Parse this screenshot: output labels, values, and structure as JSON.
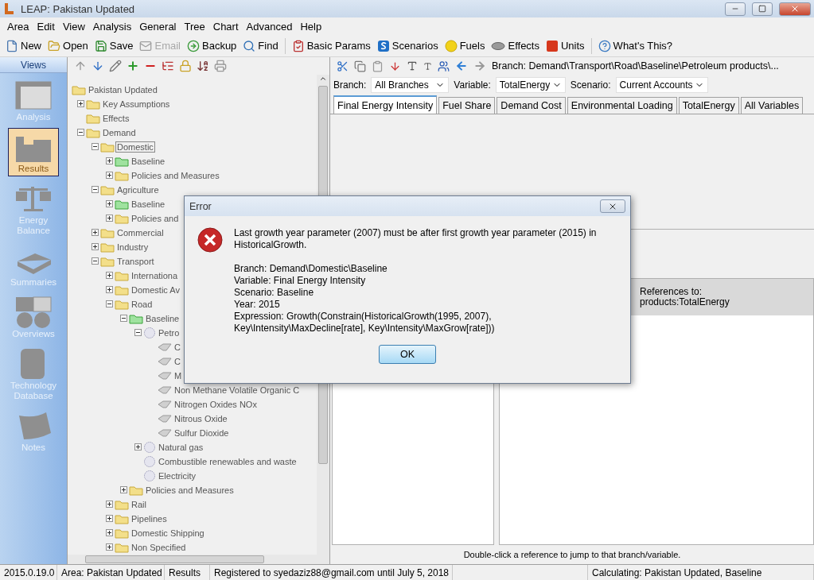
{
  "window": {
    "title": "LEAP: Pakistan Updated"
  },
  "menu": [
    "Area",
    "Edit",
    "View",
    "Analysis",
    "General",
    "Tree",
    "Chart",
    "Advanced",
    "Help"
  ],
  "toolbar": [
    {
      "label": "New",
      "disabled": false
    },
    {
      "label": "Open",
      "disabled": false
    },
    {
      "label": "Save",
      "disabled": false
    },
    {
      "label": "Email",
      "disabled": true
    },
    {
      "label": "Backup",
      "disabled": false
    },
    {
      "label": "Find",
      "disabled": false
    },
    {
      "label": "Basic Params",
      "disabled": false
    },
    {
      "label": "Scenarios",
      "disabled": false
    },
    {
      "label": "Fuels",
      "disabled": false
    },
    {
      "label": "Effects",
      "disabled": false
    },
    {
      "label": "Units",
      "disabled": false
    },
    {
      "label": "What's This?",
      "disabled": false
    }
  ],
  "views": {
    "title": "Views",
    "items": [
      {
        "label": "Analysis",
        "selected": false
      },
      {
        "label": "Results",
        "selected": true
      },
      {
        "label": "Energy Balance",
        "selected": false
      },
      {
        "label": "Summaries",
        "selected": false
      },
      {
        "label": "Overviews",
        "selected": false
      },
      {
        "label": "Technology Database",
        "selected": false
      },
      {
        "label": "Notes",
        "selected": false
      }
    ]
  },
  "tree": [
    {
      "label": "Pakistan Updated",
      "kind": "folder",
      "selected": false,
      "children": [
        {
          "label": "Key Assumptions",
          "kind": "folder",
          "selected": false,
          "expanded": false
        },
        {
          "label": "Effects",
          "kind": "folder",
          "selected": false
        },
        {
          "label": "Demand",
          "kind": "folder",
          "selected": false,
          "expanded": true,
          "children": [
            {
              "label": "Domestic",
              "kind": "folder",
              "selected": true,
              "expanded": true,
              "children": [
                {
                  "label": "Baseline",
                  "kind": "scenario",
                  "selected": false,
                  "expanded": false
                },
                {
                  "label": "Policies and Measures",
                  "kind": "folder",
                  "selected": false,
                  "expanded": false
                }
              ]
            },
            {
              "label": "Agriculture",
              "kind": "folder",
              "selected": false,
              "expanded": true,
              "children": [
                {
                  "label": "Baseline",
                  "kind": "scenario",
                  "selected": false,
                  "expanded": false
                },
                {
                  "label": "Policies and",
                  "kind": "folder",
                  "selected": false,
                  "expanded": false
                }
              ]
            },
            {
              "label": "Commercial",
              "kind": "folder",
              "selected": false,
              "expanded": false
            },
            {
              "label": "Industry",
              "kind": "folder",
              "selected": false,
              "expanded": false
            },
            {
              "label": "Transport",
              "kind": "folder",
              "selected": false,
              "expanded": true,
              "children": [
                {
                  "label": "Internationa",
                  "kind": "folder",
                  "selected": false,
                  "expanded": false
                },
                {
                  "label": "Domestic Av",
                  "kind": "folder",
                  "selected": false,
                  "expanded": false
                },
                {
                  "label": "Road",
                  "kind": "folder",
                  "selected": false,
                  "expanded": true,
                  "children": [
                    {
                      "label": "Baseline",
                      "kind": "scenario",
                      "selected": false,
                      "expanded": true,
                      "children": [
                        {
                          "label": "Petro",
                          "kind": "fuel",
                          "selected": false,
                          "expanded": true,
                          "children": [
                            {
                              "label": "C",
                              "kind": "effect",
                              "selected": false
                            },
                            {
                              "label": "C",
                              "kind": "effect",
                              "selected": false
                            },
                            {
                              "label": "M",
                              "kind": "effect",
                              "selected": false
                            },
                            {
                              "label": "Non Methane Volatile Organic C",
                              "kind": "effect",
                              "selected": false
                            },
                            {
                              "label": "Nitrogen Oxides NOx",
                              "kind": "effect",
                              "selected": false
                            },
                            {
                              "label": "Nitrous Oxide",
                              "kind": "effect",
                              "selected": false
                            },
                            {
                              "label": "Sulfur Dioxide",
                              "kind": "effect",
                              "selected": false
                            }
                          ]
                        },
                        {
                          "label": "Natural gas",
                          "kind": "fuel",
                          "selected": false,
                          "expanded": false
                        },
                        {
                          "label": "Combustible renewables and waste",
                          "kind": "fuel",
                          "selected": false
                        },
                        {
                          "label": "Electricity",
                          "kind": "fuel",
                          "selected": false
                        }
                      ]
                    },
                    {
                      "label": "Policies and Measures",
                      "kind": "folder",
                      "selected": false,
                      "expanded": false
                    }
                  ]
                },
                {
                  "label": "Rail",
                  "kind": "folder",
                  "selected": false,
                  "expanded": false
                },
                {
                  "label": "Pipelines",
                  "kind": "folder",
                  "selected": false,
                  "expanded": false
                },
                {
                  "label": "Domestic Shipping",
                  "kind": "folder",
                  "selected": false,
                  "expanded": false
                },
                {
                  "label": "Non Specified",
                  "kind": "folder",
                  "selected": false,
                  "expanded": false
                }
              ]
            }
          ]
        }
      ]
    }
  ],
  "breadcrumb": "Branch: Demand\\Transport\\Road\\Baseline\\Petroleum products\\...",
  "filters": [
    {
      "label": "Branch:",
      "value": "All Branches"
    },
    {
      "label": "Variable:",
      "value": "TotalEnergy"
    },
    {
      "label": "Scenario:",
      "value": "Current Accounts"
    }
  ],
  "tabs": [
    {
      "label": "Final Energy Intensity",
      "selected": true
    },
    {
      "label": "Fuel Share",
      "selected": false
    },
    {
      "label": "Demand Cost",
      "selected": false
    },
    {
      "label": "Environmental Loading",
      "selected": false
    },
    {
      "label": "TotalEnergy",
      "selected": false
    },
    {
      "label": "All Variables",
      "selected": false
    }
  ],
  "references": {
    "header": [
      "References to:",
      "products:TotalEnergy"
    ],
    "hint": "Double-click a reference to jump to that branch/variable."
  },
  "status_bar": [
    "2015.0.19.0",
    "Area: Pakistan Updated",
    "Results",
    "Registered to syedaziz88@gmail.com until July 5, 2018",
    "Calculating: Pakistan Updated, Baseline"
  ],
  "dialog": {
    "title": "Error",
    "message": "Last growth year parameter (2007) must be after first growth year parameter (2015) in HistoricalGrowth.",
    "details": [
      "Branch: Demand\\Domestic\\Baseline",
      "Variable: Final Energy Intensity",
      "Scenario: Baseline",
      "Year: 2015",
      "Expression: Growth(Constrain(HistoricalGrowth(1995, 2007), Key\\Intensity\\MaxDecline[rate], Key\\Intensity\\MaxGrow[rate]))"
    ],
    "button": "OK"
  }
}
